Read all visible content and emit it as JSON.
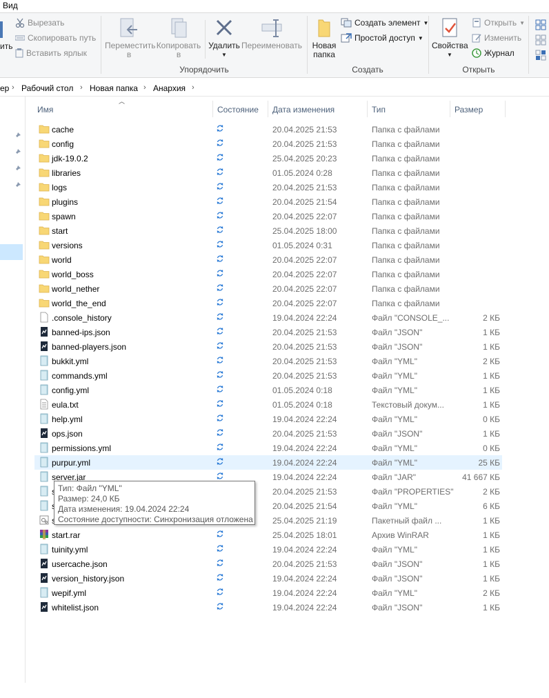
{
  "window": {
    "tab_view": "Вид"
  },
  "ribbon": {
    "clipboard": {
      "partial_label": "ить",
      "cut": "Вырезать",
      "copy_path": "Скопировать путь",
      "paste_shortcut": "Вставить ярлык"
    },
    "organize": {
      "move_to": "Переместить",
      "move_to_2": "в",
      "copy_to": "Копировать",
      "copy_to_2": "в",
      "delete": "Удалить",
      "rename": "Переименовать",
      "group_label": "Упорядочить"
    },
    "new": {
      "new_folder": "Новая",
      "new_folder_2": "папка",
      "new_item": "Создать элемент",
      "easy_access": "Простой доступ",
      "group_label": "Создать"
    },
    "open": {
      "properties": "Свойства",
      "open": "Открыть",
      "edit": "Изменить",
      "history": "Журнал",
      "group_label": "Открыть"
    }
  },
  "breadcrumb": {
    "partial": "ер",
    "items": [
      "Рабочий стол",
      "Новая папка",
      "Анархия"
    ]
  },
  "columns": {
    "name": "Имя",
    "status": "Состояние",
    "date": "Дата изменения",
    "type": "Тип",
    "size": "Размер"
  },
  "files": [
    {
      "name": "cache",
      "date": "20.04.2025 21:53",
      "type": "Папка с файлами",
      "size": "",
      "icon": "folder-icon"
    },
    {
      "name": "config",
      "date": "20.04.2025 21:53",
      "type": "Папка с файлами",
      "size": "",
      "icon": "folder-icon"
    },
    {
      "name": "jdk-19.0.2",
      "date": "25.04.2025 20:23",
      "type": "Папка с файлами",
      "size": "",
      "icon": "folder-icon"
    },
    {
      "name": "libraries",
      "date": "01.05.2024 0:28",
      "type": "Папка с файлами",
      "size": "",
      "icon": "folder-icon"
    },
    {
      "name": "logs",
      "date": "20.04.2025 21:53",
      "type": "Папка с файлами",
      "size": "",
      "icon": "folder-icon"
    },
    {
      "name": "plugins",
      "date": "20.04.2025 21:54",
      "type": "Папка с файлами",
      "size": "",
      "icon": "folder-icon"
    },
    {
      "name": "spawn",
      "date": "20.04.2025 22:07",
      "type": "Папка с файлами",
      "size": "",
      "icon": "folder-icon"
    },
    {
      "name": "start",
      "date": "25.04.2025 18:00",
      "type": "Папка с файлами",
      "size": "",
      "icon": "folder-icon"
    },
    {
      "name": "versions",
      "date": "01.05.2024 0:31",
      "type": "Папка с файлами",
      "size": "",
      "icon": "folder-icon"
    },
    {
      "name": "world",
      "date": "20.04.2025 22:07",
      "type": "Папка с файлами",
      "size": "",
      "icon": "folder-icon"
    },
    {
      "name": "world_boss",
      "date": "20.04.2025 22:07",
      "type": "Папка с файлами",
      "size": "",
      "icon": "folder-icon"
    },
    {
      "name": "world_nether",
      "date": "20.04.2025 22:07",
      "type": "Папка с файлами",
      "size": "",
      "icon": "folder-icon"
    },
    {
      "name": "world_the_end",
      "date": "20.04.2025 22:07",
      "type": "Папка с файлами",
      "size": "",
      "icon": "folder-icon"
    },
    {
      "name": ".console_history",
      "date": "19.04.2024 22:24",
      "type": "Файл \"CONSOLE_...",
      "size": "2 КБ",
      "icon": "file-icon"
    },
    {
      "name": "banned-ips.json",
      "date": "20.04.2025 21:53",
      "type": "Файл \"JSON\"",
      "size": "1 КБ",
      "icon": "json-file-icon"
    },
    {
      "name": "banned-players.json",
      "date": "20.04.2025 21:53",
      "type": "Файл \"JSON\"",
      "size": "1 КБ",
      "icon": "json-file-icon"
    },
    {
      "name": "bukkit.yml",
      "date": "20.04.2025 21:53",
      "type": "Файл \"YML\"",
      "size": "2 КБ",
      "icon": "yml-file-icon"
    },
    {
      "name": "commands.yml",
      "date": "20.04.2025 21:53",
      "type": "Файл \"YML\"",
      "size": "1 КБ",
      "icon": "yml-file-icon"
    },
    {
      "name": "config.yml",
      "date": "01.05.2024 0:18",
      "type": "Файл \"YML\"",
      "size": "1 КБ",
      "icon": "yml-file-icon"
    },
    {
      "name": "eula.txt",
      "date": "01.05.2024 0:18",
      "type": "Текстовый докум...",
      "size": "1 КБ",
      "icon": "text-file-icon"
    },
    {
      "name": "help.yml",
      "date": "19.04.2024 22:24",
      "type": "Файл \"YML\"",
      "size": "0 КБ",
      "icon": "yml-file-icon"
    },
    {
      "name": "ops.json",
      "date": "20.04.2025 21:53",
      "type": "Файл \"JSON\"",
      "size": "1 КБ",
      "icon": "json-file-icon"
    },
    {
      "name": "permissions.yml",
      "date": "19.04.2024 22:24",
      "type": "Файл \"YML\"",
      "size": "0 КБ",
      "icon": "yml-file-icon"
    },
    {
      "name": "purpur.yml",
      "date": "19.04.2024 22:24",
      "type": "Файл \"YML\"",
      "size": "25 КБ",
      "icon": "yml-file-icon",
      "highlight": true
    },
    {
      "name": "server.jar",
      "date": "19.04.2024 22:24",
      "type": "Файл \"JAR\"",
      "size": "41 667 КБ",
      "icon": "yml-file-icon"
    },
    {
      "name": "s",
      "date": "20.04.2025 21:53",
      "type": "Файл \"PROPERTIES\"",
      "size": "2 КБ",
      "icon": "yml-file-icon"
    },
    {
      "name": "s",
      "date": "20.04.2025 21:54",
      "type": "Файл \"YML\"",
      "size": "6 КБ",
      "icon": "yml-file-icon"
    },
    {
      "name": "s",
      "date": "25.04.2025 21:19",
      "type": "Пакетный файл ...",
      "size": "1 КБ",
      "icon": "batch-file-icon"
    },
    {
      "name": "start.rar",
      "date": "25.04.2025 18:01",
      "type": "Архив WinRAR",
      "size": "1 КБ",
      "icon": "winrar-icon"
    },
    {
      "name": "tuinity.yml",
      "date": "19.04.2024 22:24",
      "type": "Файл \"YML\"",
      "size": "1 КБ",
      "icon": "yml-file-icon"
    },
    {
      "name": "usercache.json",
      "date": "20.04.2025 21:53",
      "type": "Файл \"JSON\"",
      "size": "1 КБ",
      "icon": "json-file-icon"
    },
    {
      "name": "version_history.json",
      "date": "19.04.2024 22:24",
      "type": "Файл \"JSON\"",
      "size": "1 КБ",
      "icon": "json-file-icon"
    },
    {
      "name": "wepif.yml",
      "date": "19.04.2024 22:24",
      "type": "Файл \"YML\"",
      "size": "2 КБ",
      "icon": "yml-file-icon"
    },
    {
      "name": "whitelist.json",
      "date": "19.04.2024 22:24",
      "type": "Файл \"JSON\"",
      "size": "1 КБ",
      "icon": "json-file-icon"
    }
  ],
  "tooltip": {
    "type_line": "Тип: Файл \"YML\"",
    "size_line": "Размер: 24,0 КБ",
    "date_line": "Дата изменения: 19.04.2024 22:24",
    "status_line": "Состояние доступности: Синхронизация отложена"
  },
  "colors": {
    "accent": "#0078d7",
    "folder": "#f8d775",
    "header_text": "#4c607a",
    "selection": "#cce8ff",
    "hover": "#e5f3ff"
  }
}
